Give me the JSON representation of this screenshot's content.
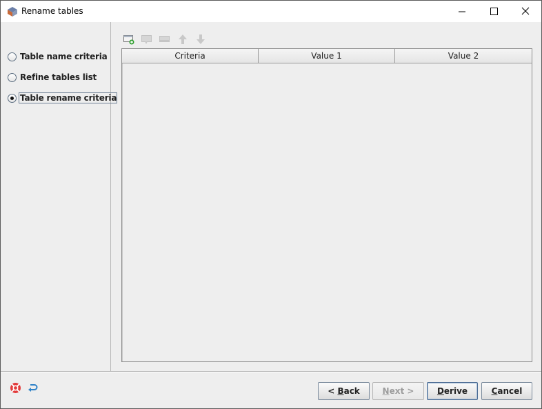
{
  "window": {
    "title": "Rename tables",
    "app_icon": "app-logo-icon",
    "controls": [
      "minimize-icon",
      "maximize-icon",
      "close-icon"
    ]
  },
  "steps": [
    {
      "label": "Table name criteria",
      "selected": false
    },
    {
      "label": "Refine tables list",
      "selected": false
    },
    {
      "label": "Table rename criteria",
      "selected": true
    }
  ],
  "toolbar": {
    "icons": [
      "add-row-icon",
      "edit-row-icon",
      "delete-row-icon",
      "move-up-icon",
      "move-down-icon"
    ],
    "enabled": [
      true,
      false,
      false,
      false,
      false
    ]
  },
  "table": {
    "columns": [
      "Criteria",
      "Value 1",
      "Value 2"
    ],
    "rows": []
  },
  "footer": {
    "left_icons": [
      "help-icon",
      "undo-icon"
    ],
    "buttons": {
      "back": {
        "mnemonic": "B",
        "before": "< ",
        "after": "ack",
        "enabled": true
      },
      "next": {
        "mnemonic": "N",
        "before": "",
        "after": "ext >",
        "enabled": false
      },
      "derive": {
        "mnemonic": "D",
        "before": "",
        "after": "erive",
        "enabled": true
      },
      "cancel": {
        "mnemonic": "C",
        "before": "",
        "after": "ancel",
        "enabled": true
      }
    }
  },
  "colors": {
    "panel_bg": "#eeeeee",
    "titlebar_bg": "#ffffff",
    "accent_green": "#2e9e2e",
    "button_border_default": "#4c6c94"
  }
}
